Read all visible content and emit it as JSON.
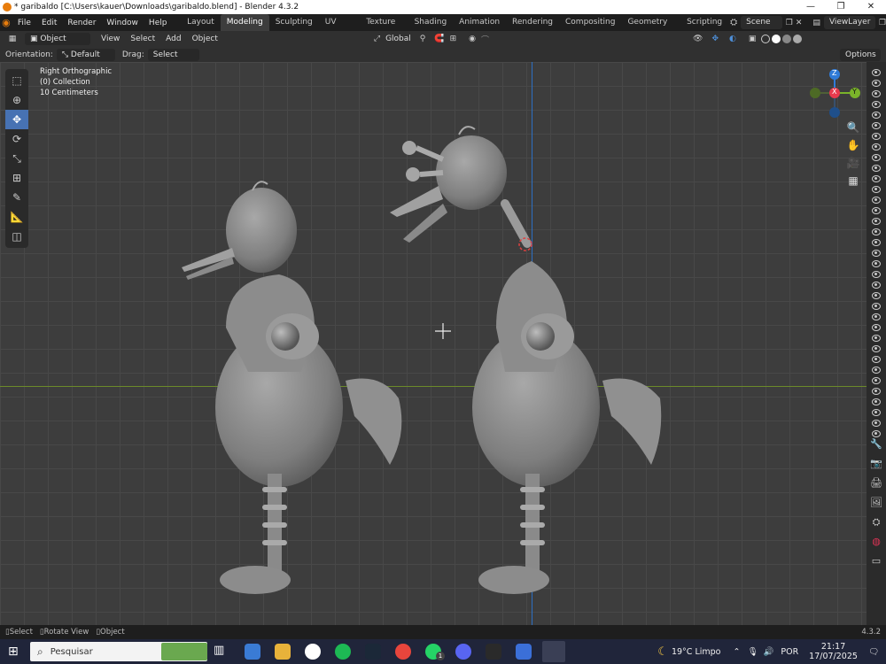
{
  "window": {
    "title": "* garibaldo [C:\\Users\\kauer\\Downloads\\garibaldo.blend] - Blender 4.3.2",
    "controls": [
      "—",
      "❐",
      "✕"
    ]
  },
  "topbar": {
    "menus": [
      "File",
      "Edit",
      "Render",
      "Window",
      "Help"
    ],
    "workspaces": [
      "Layout",
      "Modeling",
      "Sculpting",
      "UV Editing",
      "Texture Paint",
      "Shading",
      "Animation",
      "Rendering",
      "Compositing",
      "Geometry Nodes",
      "Scripting"
    ],
    "active_workspace": "Modeling",
    "scene": "Scene",
    "view_layer": "ViewLayer"
  },
  "header": {
    "mode": "Object Mode",
    "menus": [
      "View",
      "Select",
      "Add",
      "Object"
    ],
    "transform_orientation": "Global"
  },
  "tool_settings": {
    "orientation_label": "Orientation:",
    "orientation_value": "Default",
    "drag_label": "Drag:",
    "drag_value": "Select Box",
    "options": "Options"
  },
  "viewport": {
    "view_name": "Right Orthographic",
    "collection": "(0) Collection",
    "scale": "10 Centimeters",
    "gizmo_axes": {
      "z": "Z",
      "x": "X",
      "y": "Y"
    },
    "colors": {
      "x": "#e83a4d",
      "y": "#7ab32a",
      "z": "#2f7bd8",
      "horizon": "#6b8a2a",
      "vertical_axis": "#2c6fc2"
    }
  },
  "statusbar": {
    "items": [
      "Select",
      "Rotate View",
      "Object"
    ],
    "version": "4.3.2"
  },
  "taskbar": {
    "search_placeholder": "Pesquisar",
    "weather": "19°C  Limpo",
    "language": "POR",
    "time": "21:17",
    "date": "17/07/2025",
    "badge": "1"
  }
}
